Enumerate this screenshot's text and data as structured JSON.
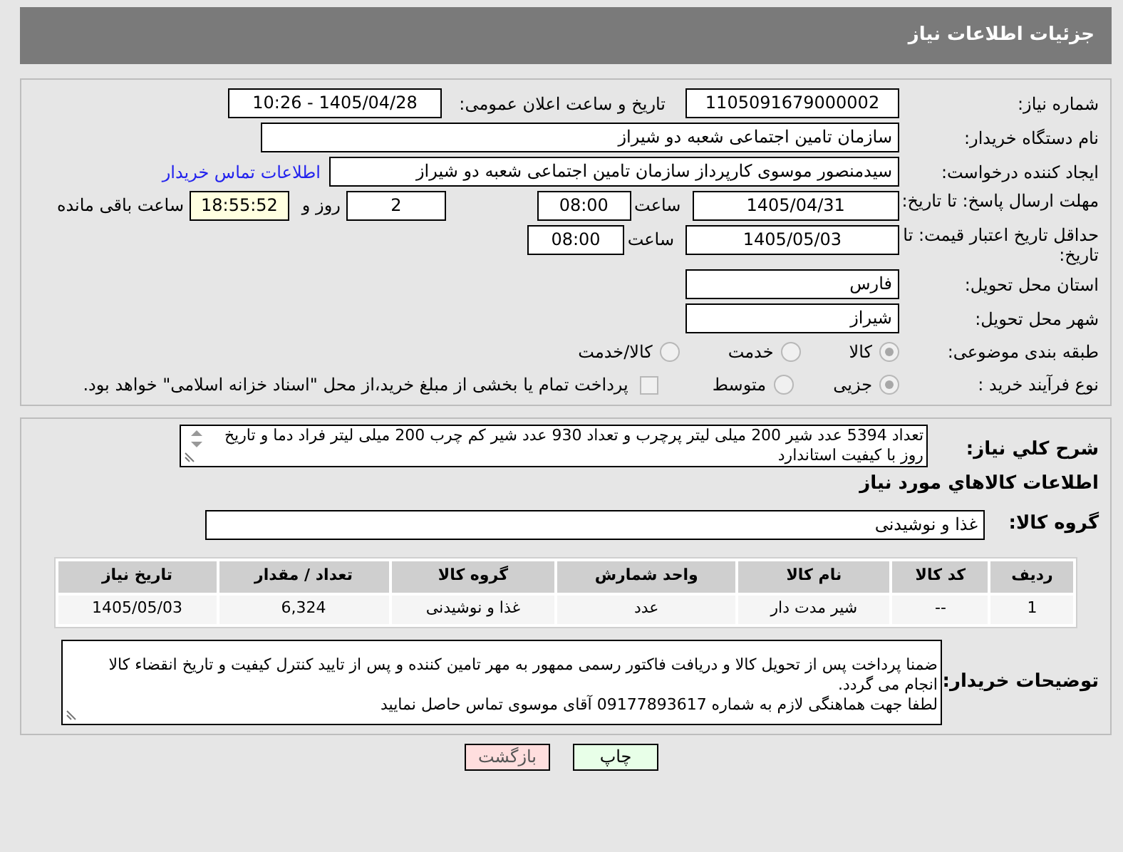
{
  "header": {
    "title": "جزئیات اطلاعات نیاز"
  },
  "form": {
    "need_number": {
      "label": "شماره نیاز:",
      "value": "1105091679000002"
    },
    "announce": {
      "label": "تاریخ و ساعت اعلان عمومی:",
      "value": "1405/04/28 - 10:26"
    },
    "buyer_org": {
      "label": "نام دستگاه خریدار:",
      "value": "سازمان تامین اجتماعی شعبه دو شیراز"
    },
    "creator": {
      "label": "ایجاد کننده درخواست:",
      "value": "سیدمنصور موسوی کارپرداز سازمان تامین اجتماعی شعبه دو شیراز",
      "link": "اطلاعات تماس خریدار"
    },
    "deadline": {
      "label": "مهلت ارسال پاسخ: تا تاریخ:",
      "date": "1405/04/31",
      "time_label": "ساعت",
      "time": "08:00",
      "days": "2",
      "days_label": "روز و",
      "remaining": "18:55:52",
      "remaining_label": "ساعت باقی مانده"
    },
    "price_validity": {
      "label": "حداقل تاریخ اعتبار قیمت: تا تاریخ:",
      "date": "1405/05/03",
      "time_label": "ساعت",
      "time": "08:00"
    },
    "province": {
      "label": "استان محل تحویل:",
      "value": "فارس"
    },
    "city": {
      "label": "شهر محل تحویل:",
      "value": "شیراز"
    },
    "category": {
      "label": "طبقه بندی موضوعی:",
      "options": [
        {
          "label": "کالا",
          "selected": true
        },
        {
          "label": "خدمت",
          "selected": false
        },
        {
          "label": "کالا/خدمت",
          "selected": false
        }
      ]
    },
    "process": {
      "label": "نوع فرآیند خرید :",
      "options": [
        {
          "label": "جزیی",
          "selected": true
        },
        {
          "label": "متوسط",
          "selected": false
        }
      ],
      "treasury": {
        "checked": false,
        "label": "پرداخت تمام یا بخشی از مبلغ خرید،از محل \"اسناد خزانه اسلامی\" خواهد بود."
      }
    }
  },
  "details": {
    "description": {
      "label": "شرح کلي نیاز:",
      "value": "تعداد 5394 عدد شیر 200 میلی لیتر پرچرب و تعداد 930 عدد شیر کم چرب 200 میلی لیتر فراد دما و  تاریخ روز با کیفیت استاندارد"
    },
    "goods_title": "اطلاعات کالاهاي مورد نیاز",
    "goods_group": {
      "label": "گروه کالا:",
      "value": "غذا و نوشیدنی"
    },
    "table": {
      "columns": [
        "ردیف",
        "کد کالا",
        "نام کالا",
        "واحد شمارش",
        "گروه کالا",
        "تعداد / مقدار",
        "تاریخ نیاز"
      ],
      "rows": [
        [
          "1",
          "--",
          "شیر مدت دار",
          "عدد",
          "غذا و نوشیدنی",
          "6,324",
          "1405/05/03"
        ]
      ]
    },
    "buyer_notes": {
      "label": "توضیحات خریدار:",
      "paragraphs": [
        "ضمنا پرداخت پس از تحویل کالا و دریافت فاکتور رسمی ممهور به مهر تامین کننده و پس از تایید کنترل کیفیت و تاریخ انقضاء کالا انجام می گردد.",
        "لطفا جهت هماهنگی لازم به شماره 09177893617 آقای موسوی تماس حاصل نمایید"
      ]
    }
  },
  "buttons": [
    {
      "kind": "print",
      "label": "چاپ"
    },
    {
      "kind": "back",
      "label": "بازگشت"
    }
  ]
}
